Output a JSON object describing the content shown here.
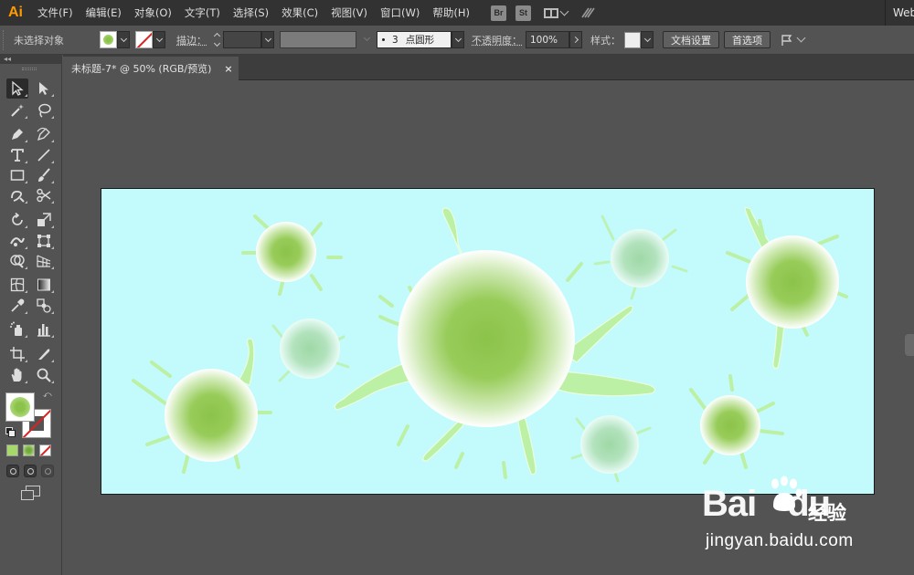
{
  "app": {
    "logo": "Ai",
    "workspace_label": "Web"
  },
  "menu": [
    "文件(F)",
    "编辑(E)",
    "对象(O)",
    "文字(T)",
    "选择(S)",
    "效果(C)",
    "视图(V)",
    "窗口(W)",
    "帮助(H)"
  ],
  "bridge_badges": {
    "bridge": "Br",
    "stock": "St"
  },
  "control_bar": {
    "selection_status": "未选择对象",
    "stroke_label": "描边：",
    "stroke_weight": "",
    "brush_size": "3",
    "brush_name": "点圆形",
    "opacity_label": "不透明度：",
    "opacity_value": "100%",
    "style_label": "样式：",
    "doc_setup_button": "文档设置",
    "preferences_button": "首选项"
  },
  "document_tab": {
    "title": "未标题-7* @ 50% (RGB/预览)",
    "close": "×"
  },
  "artboard": {
    "background_color": "#c3fbfd",
    "splat_color": "#bcf0a4",
    "sphere_core_color": "#8bc34a"
  },
  "watermark": {
    "logo_left": "Bai",
    "logo_right": "du",
    "logo_cn": "经验",
    "url": "jingyan.baidu.com"
  }
}
